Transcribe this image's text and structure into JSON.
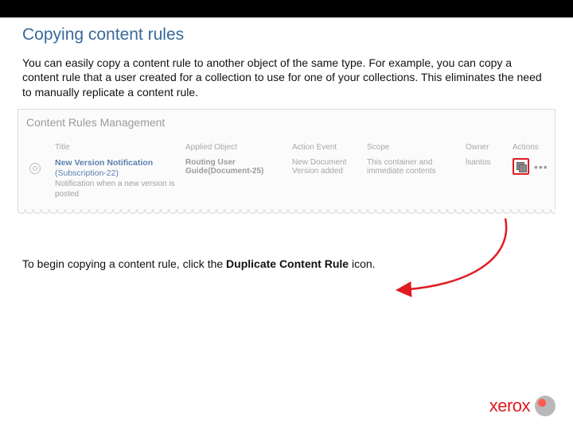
{
  "heading": "Copying content rules",
  "intro": "You can easily copy a content rule to another object of the same type. For example, you can copy a content rule that a user created for a collection to use for one of your collections. This eliminates the need to manually replicate a content rule.",
  "panel": {
    "title": "Content Rules Management",
    "columns": {
      "title": "Title",
      "applied": "Applied Object",
      "action": "Action Event",
      "scope": "Scope",
      "owner": "Owner",
      "actions": "Actions"
    },
    "row": {
      "ruleTitle": "New Version Notification",
      "ruleSub": "(Subscription-22)",
      "ruleDesc": "Notification when a new version is posted",
      "applied": "Routing User Guide(Document-25)",
      "action1": "New Document",
      "action2": "Version added",
      "scope": "This container and immediate contents",
      "owner": "lsantos"
    }
  },
  "caption_pre": "To begin copying a content rule, click the ",
  "caption_bold": "Duplicate Content Rule",
  "caption_post": " icon.",
  "logo": "xerox"
}
